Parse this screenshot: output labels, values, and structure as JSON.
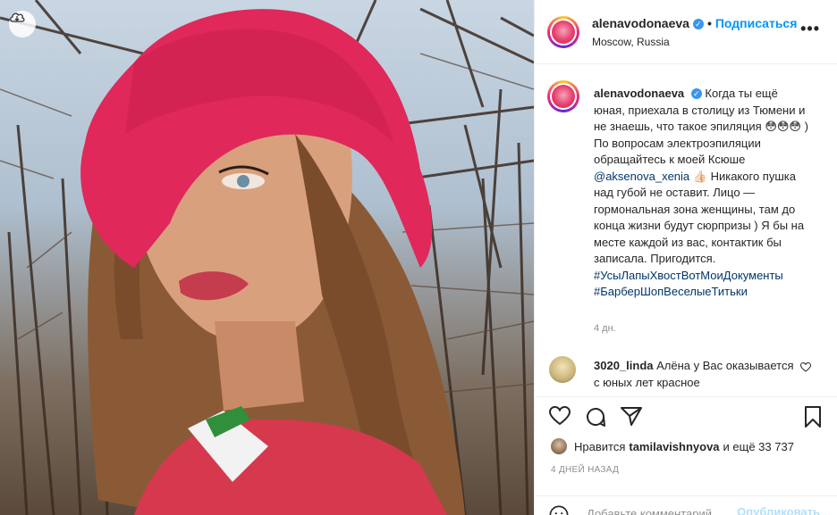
{
  "header": {
    "username": "alenavodonaeva",
    "separator": "•",
    "follow_label": "Подписаться",
    "location": "Moscow, Russia",
    "more_label": "•••"
  },
  "caption": {
    "username": "alenavodonaeva",
    "text_before_mention": "Когда ты ещё юная, приехала в столицу из Тюмени и не знаешь, что такое эпиляция 😳😳😳 ) По вопросам электроэпиляции обращайтесь к моей Ксюше",
    "mention": "@aksenova_xenia",
    "text_after_mention": "👍🏻 Никакого пушка над губой не оставит. Лицо — гормональная зона женщины, там до конца жизни будут сюрпризы ) Я бы на месте каждой из вас, контактик бы записала. Пригодится.",
    "hashtag1": "#УсыЛапыХвостВотМоиДокументы",
    "hashtag2": "#БарберШопВеселыеТитьки",
    "time": "4 дн."
  },
  "comment": {
    "username": "3020_linda",
    "text": "Алёна у Вас оказывается с юных лет красное"
  },
  "likes": {
    "prefix": "Нравится",
    "user": "tamilavishnyova",
    "suffix": "и ещё 33 737"
  },
  "date": "4 ДНЕЙ НАЗАД",
  "add_comment": {
    "placeholder": "Добавьте комментарий...",
    "post_label": "Опубликовать"
  },
  "colors": {
    "accent": "#0095f6",
    "hat": "#e0285a",
    "link": "#00376b"
  }
}
